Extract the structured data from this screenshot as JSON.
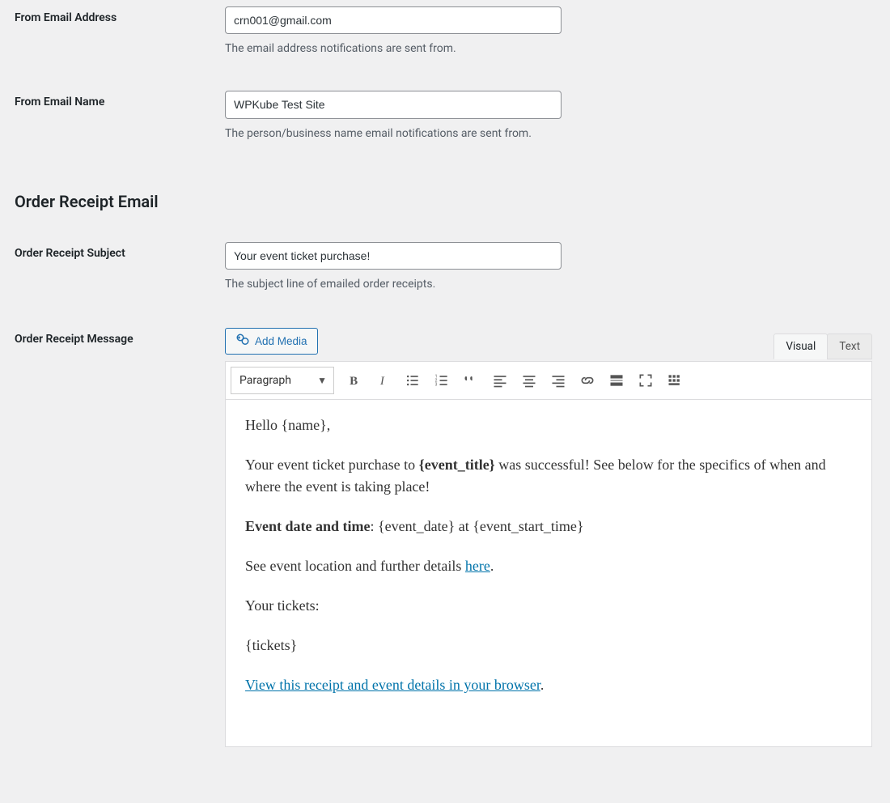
{
  "fields": {
    "from_email": {
      "label": "From Email Address",
      "value": "crn001@gmail.com",
      "help": "The email address notifications are sent from."
    },
    "from_name": {
      "label": "From Email Name",
      "value": "WPKube Test Site",
      "help": "The person/business name email notifications are sent from."
    },
    "receipt_subject": {
      "label": "Order Receipt Subject",
      "value": "Your event ticket purchase!",
      "help": "The subject line of emailed order receipts."
    },
    "receipt_message_label": "Order Receipt Message"
  },
  "section_title": "Order Receipt Email",
  "editor": {
    "add_media": "Add Media",
    "tabs": {
      "visual": "Visual",
      "text": "Text"
    },
    "format_label": "Paragraph",
    "message": {
      "greeting": "Hello {name},",
      "line1_a": "Your event ticket purchase to ",
      "line1_b": "{event_title}",
      "line1_c": " was successful! See below for the specifics of when and where the event is taking place!",
      "line2_a": "Event date and time",
      "line2_b": ": {event_date} at {event_start_time}",
      "line3_a": "See event location and further details ",
      "line3_link": "here",
      "line3_b": ".",
      "line4": "Your tickets:",
      "line5": "{tickets}",
      "line6_link": "View this receipt and event details in your browser",
      "line6_b": "."
    }
  }
}
